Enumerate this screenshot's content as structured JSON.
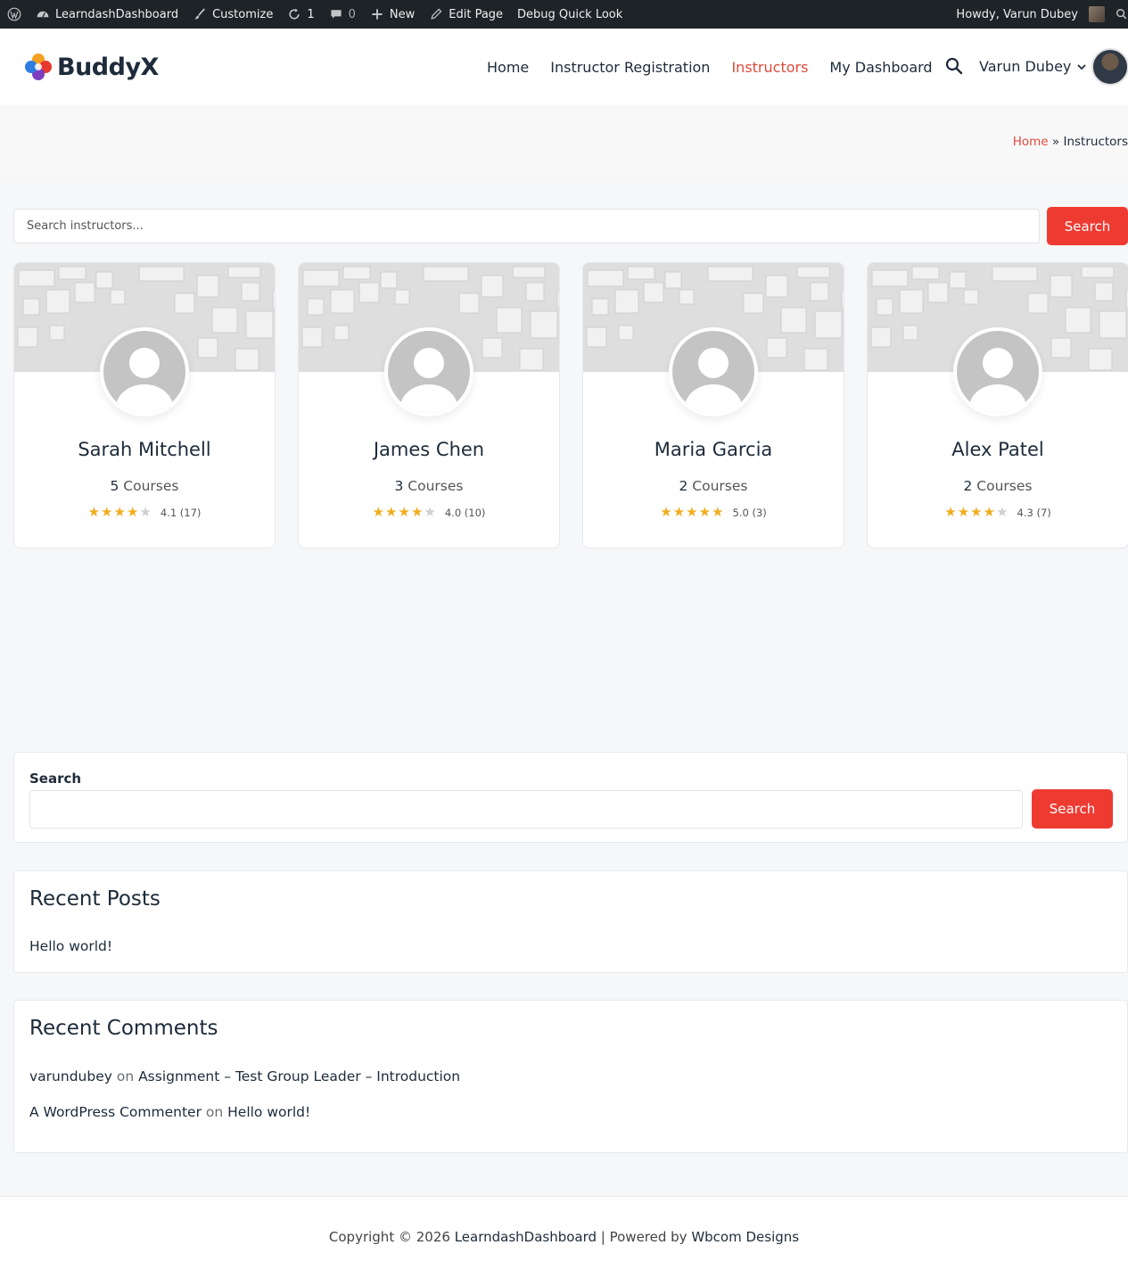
{
  "adminbar": {
    "site_name": "LearndashDashboard",
    "customize": "Customize",
    "updates_count": "1",
    "comments_count": "0",
    "new": "New",
    "edit_page": "Edit Page",
    "debug": "Debug Quick Look",
    "howdy": "Howdy, Varun Dubey"
  },
  "header": {
    "logo_text": "BuddyX",
    "nav": [
      {
        "label": "Home"
      },
      {
        "label": "Instructor Registration"
      },
      {
        "label": "Instructors",
        "active": true
      },
      {
        "label": "My Dashboard"
      }
    ],
    "user_name": "Varun Dubey"
  },
  "breadcrumb": {
    "home": "Home",
    "sep": " » ",
    "current": "Instructors"
  },
  "instructor_search": {
    "placeholder": "Search instructors...",
    "button": "Search"
  },
  "instructors": [
    {
      "name": "Sarah Mitchell",
      "courses": "5",
      "courses_label": " Courses",
      "rating": 4.1,
      "stars_filled": 4,
      "rating_text": "4.1 (17)"
    },
    {
      "name": "James Chen",
      "courses": "3",
      "courses_label": " Courses",
      "rating": 4.0,
      "stars_filled": 4,
      "rating_text": "4.0 (10)"
    },
    {
      "name": "Maria Garcia",
      "courses": "2",
      "courses_label": " Courses",
      "rating": 5.0,
      "stars_filled": 5,
      "rating_text": "5.0 (3)"
    },
    {
      "name": "Alex Patel",
      "courses": "2",
      "courses_label": " Courses",
      "rating": 4.3,
      "stars_filled": 4,
      "rating_text": "4.3 (7)"
    }
  ],
  "widgets": {
    "search": {
      "label": "Search",
      "button": "Search"
    },
    "recent_posts": {
      "title": "Recent Posts",
      "items": [
        "Hello world!"
      ]
    },
    "recent_comments": {
      "title": "Recent Comments",
      "items": [
        {
          "author": "varundubey",
          "on": " on ",
          "post": "Assignment – Test Group Leader – Introduction"
        },
        {
          "author": "A WordPress Commenter",
          "on": " on ",
          "post": "Hello world!"
        }
      ]
    }
  },
  "footer": {
    "prefix": "Copyright © 2026 ",
    "site": "LearndashDashboard",
    "middle": " | Powered by ",
    "powered": "Wbcom Designs"
  },
  "colors": {
    "accent": "#ee3b32",
    "link_active": "#e14a3b",
    "star": "#f0ad1f",
    "adminbar": "#1d2327"
  }
}
